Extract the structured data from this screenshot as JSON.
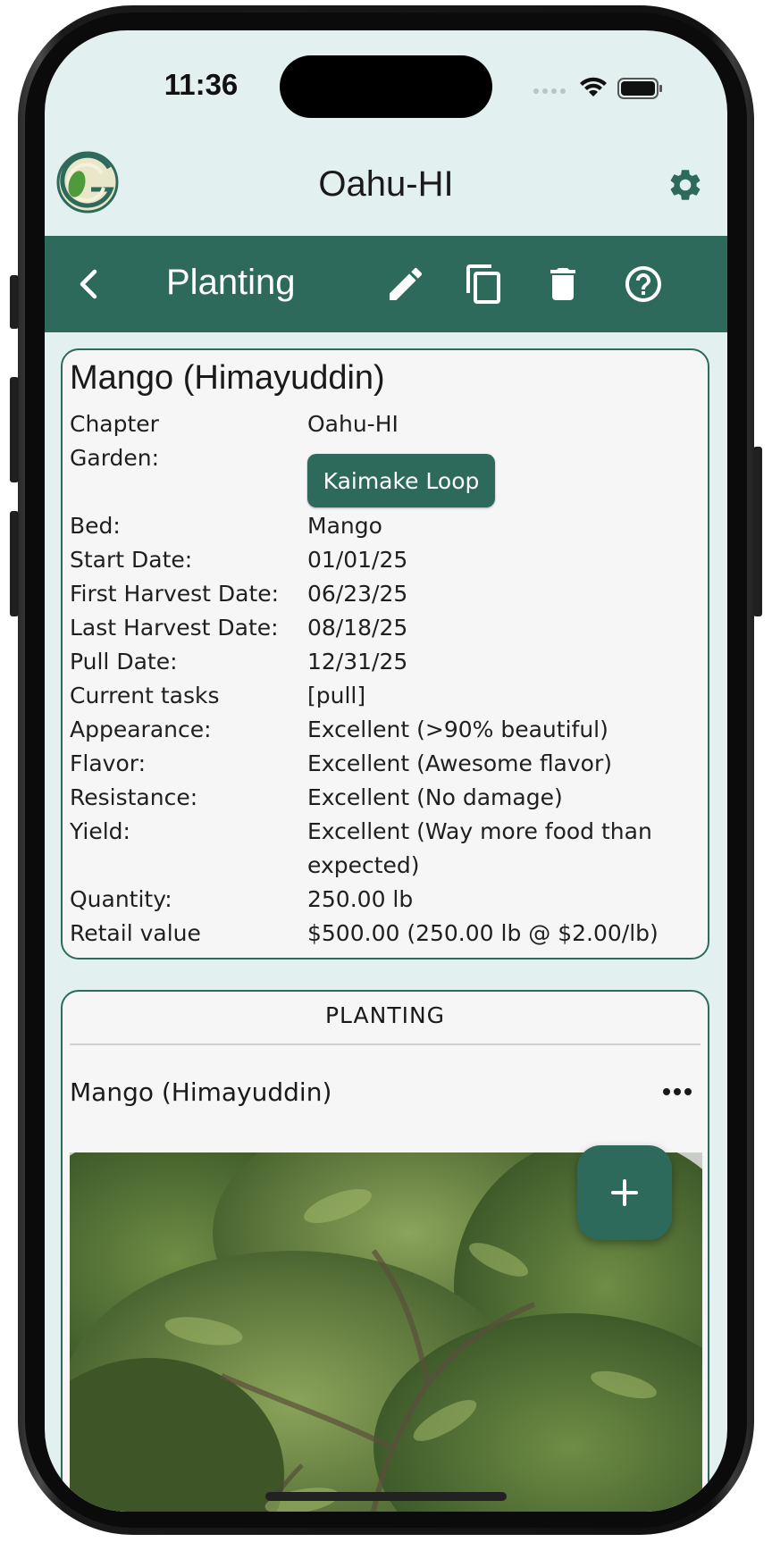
{
  "status_bar": {
    "time": "11:36"
  },
  "header": {
    "app_title": "Oahu-HI"
  },
  "toolbar": {
    "title": "Planting"
  },
  "detail": {
    "title": "Mango (Himayuddin)",
    "garden_button": "Kaimake Loop",
    "rows": [
      {
        "label": "Chapter",
        "value": "Oahu-HI"
      },
      {
        "label": "Garden:",
        "value": ""
      },
      {
        "label": "Bed:",
        "value": "Mango"
      },
      {
        "label": "Start Date:",
        "value": "01/01/25"
      },
      {
        "label": "First Harvest Date:",
        "value": "06/23/25"
      },
      {
        "label": "Last Harvest Date:",
        "value": "08/18/25"
      },
      {
        "label": "Pull Date:",
        "value": "12/31/25"
      },
      {
        "label": "Current tasks",
        "value": "[pull]"
      },
      {
        "label": "Appearance:",
        "value": "Excellent (>90% beautiful)"
      },
      {
        "label": "Flavor:",
        "value": "Excellent (Awesome flavor)"
      },
      {
        "label": "Resistance:",
        "value": "Excellent (No damage)"
      },
      {
        "label": "Yield:",
        "value": "Excellent (Way more food than expected)"
      },
      {
        "label": "Quantity:",
        "value": "250.00 lb"
      },
      {
        "label": "Retail value",
        "value": "$500.00 (250.00 lb @ $2.00/lb)"
      }
    ]
  },
  "planting_section": {
    "heading": "PLANTING",
    "item_title": "Mango (Himayuddin)"
  },
  "icons": {
    "logo": "og-logo-icon",
    "settings": "gear-icon",
    "back": "chevron-left-icon",
    "edit": "pencil-icon",
    "copy": "copy-icon",
    "delete": "trash-icon",
    "help": "help-circle-icon",
    "more": "more-horizontal-icon",
    "add": "plus-icon"
  },
  "colors": {
    "primary": "#2e6a5c",
    "background": "#e3f0f0",
    "card": "#f6f6f6"
  }
}
